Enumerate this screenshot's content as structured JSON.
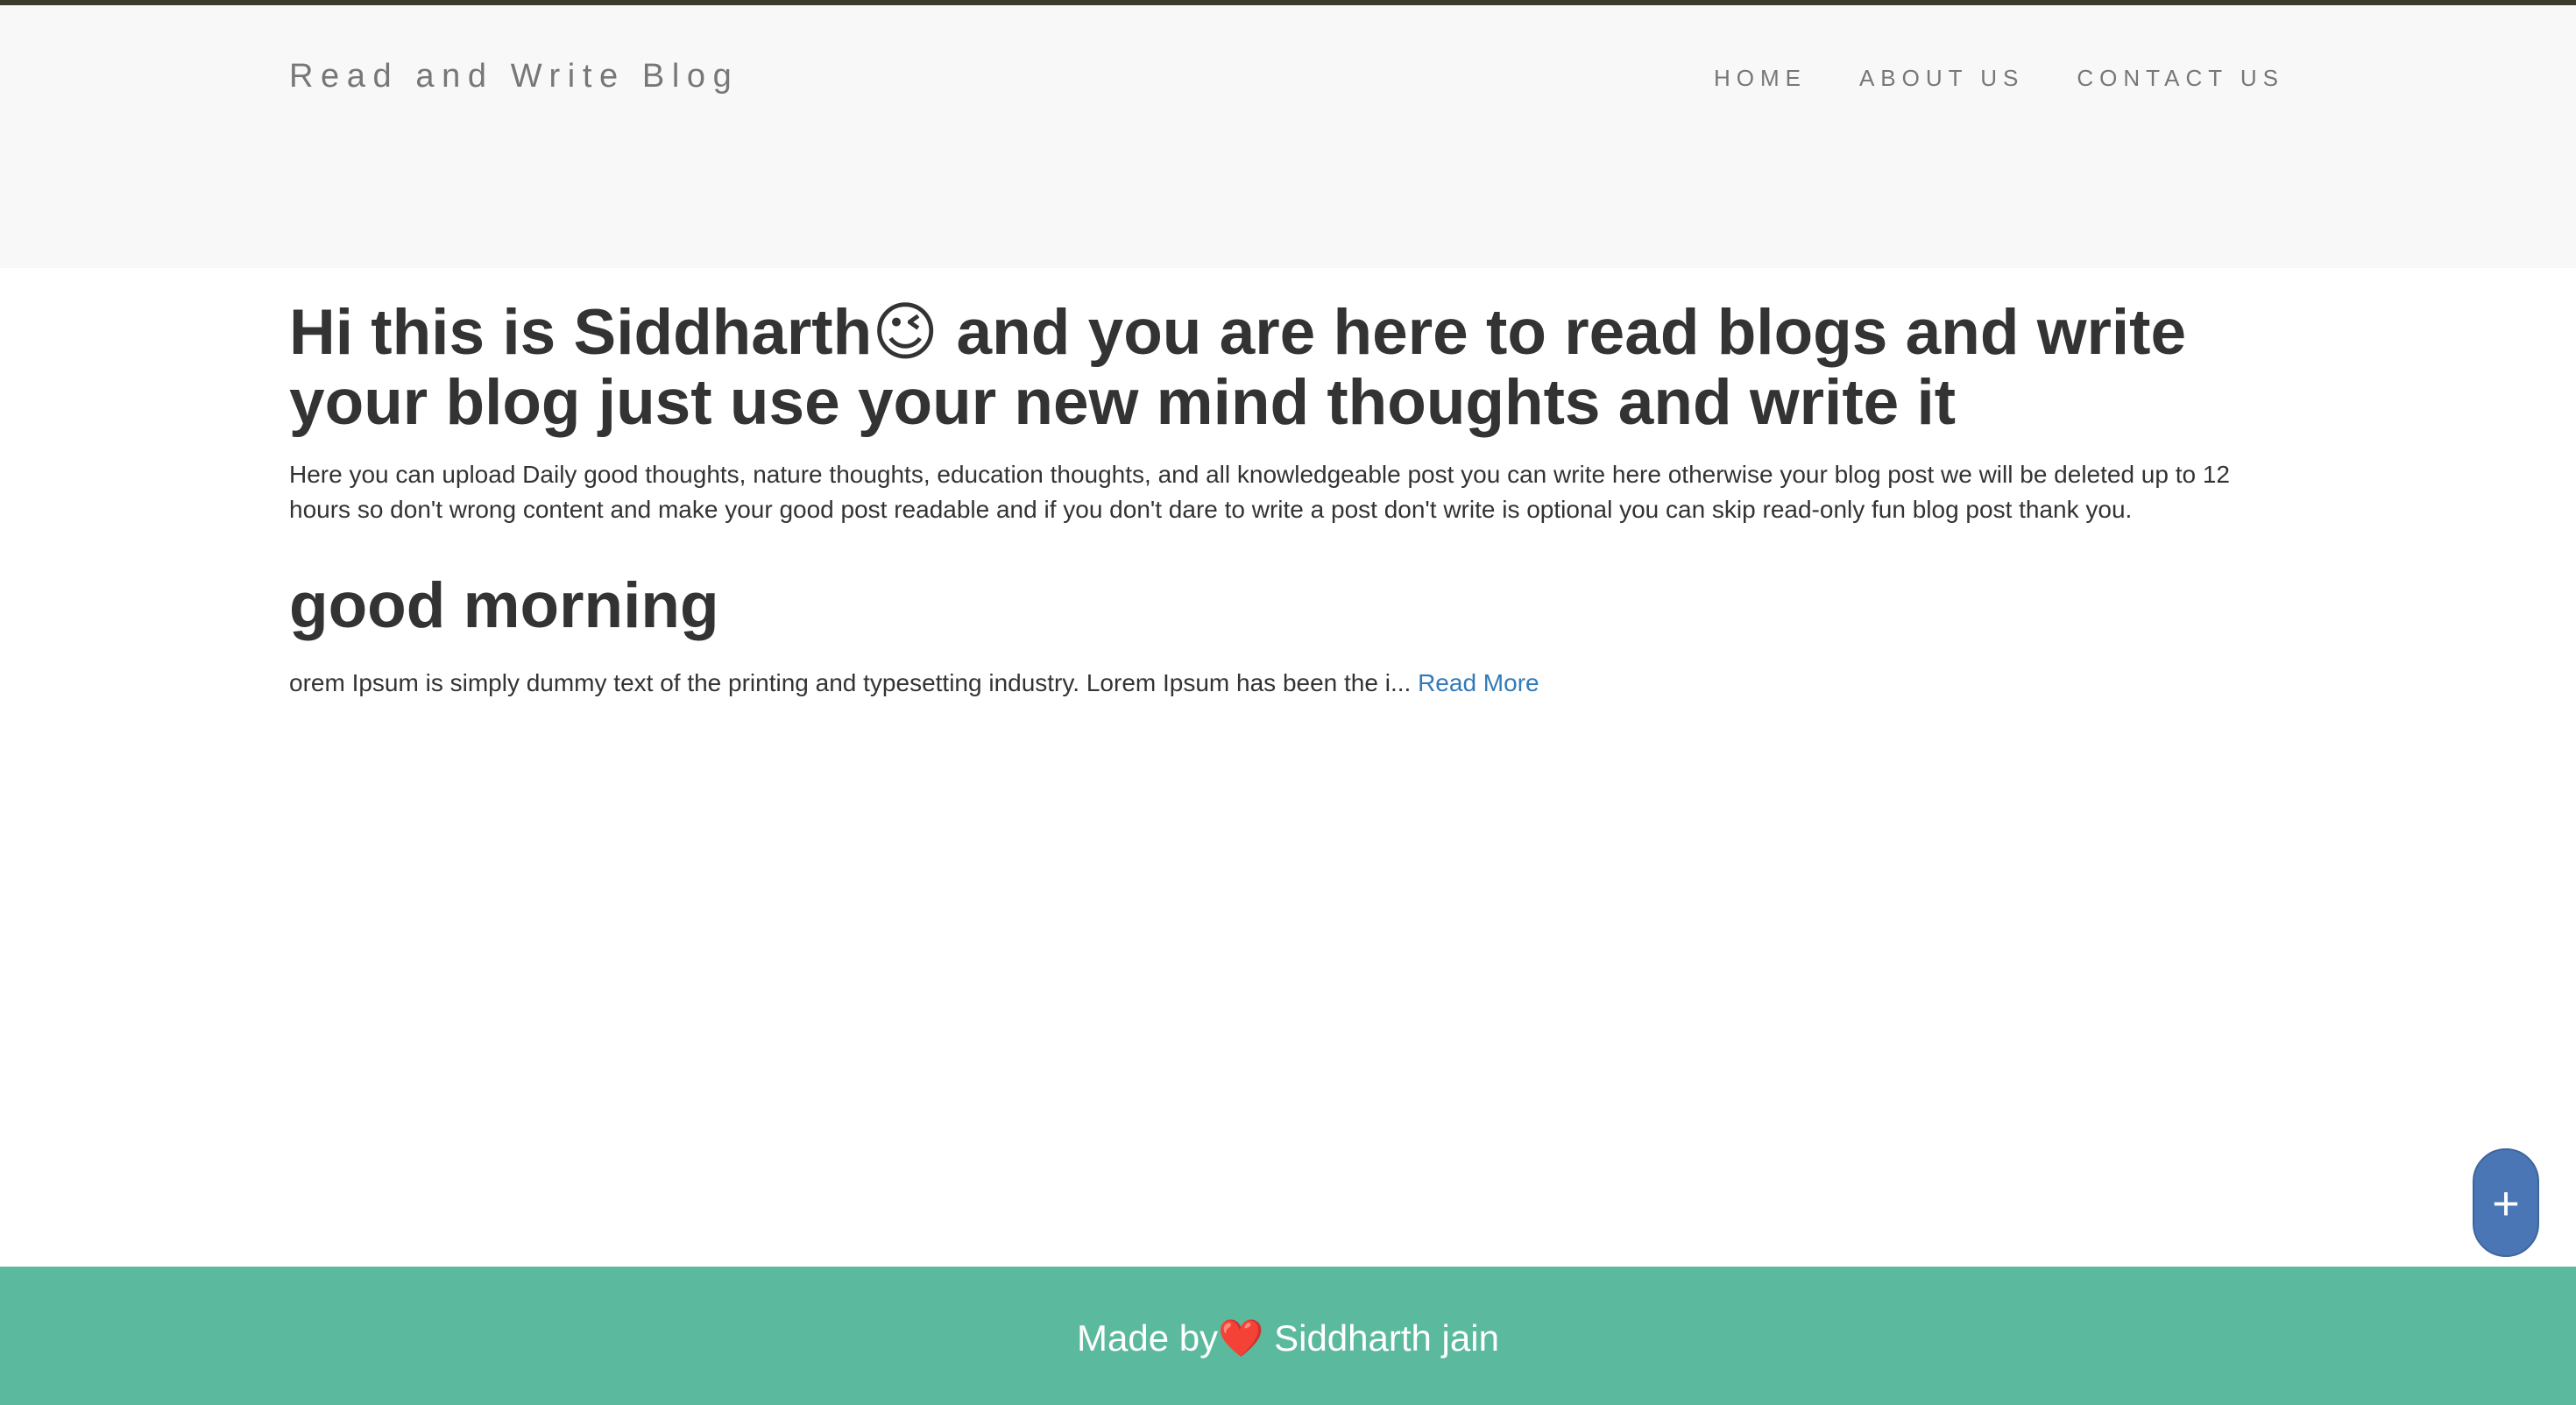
{
  "navbar": {
    "brand": "Read and Write Blog",
    "links": [
      "HOME",
      "ABOUT US",
      "CONTACT US"
    ]
  },
  "hero": {
    "title": "Hi this is Siddharth😉 and you are here to read blogs and write your blog just use your new mind thoughts and write it",
    "text": "Here you can upload Daily good thoughts, nature thoughts, education thoughts, and all knowledgeable post you can write here otherwise your blog post we will be deleted up to 12 hours so don't wrong content and make your good post readable and if you don't dare to write a post don't write is optional you can skip read-only fun blog post thank you."
  },
  "posts": [
    {
      "title": "good morning",
      "excerpt": "orem Ipsum is simply dummy text of the printing and typesetting industry. Lorem Ipsum has been the i... ",
      "read_more": "Read More"
    }
  ],
  "fab": {
    "label": "+"
  },
  "footer": {
    "text": "Made by❤️ Siddharth jain"
  },
  "colors": {
    "navbar_bg": "#f8f8f8",
    "footer_bg": "#5bba9d",
    "fab_bg": "#4a76b6",
    "link": "#337ab7",
    "text": "#333333"
  },
  "icons": {
    "fab": "plus-icon"
  }
}
